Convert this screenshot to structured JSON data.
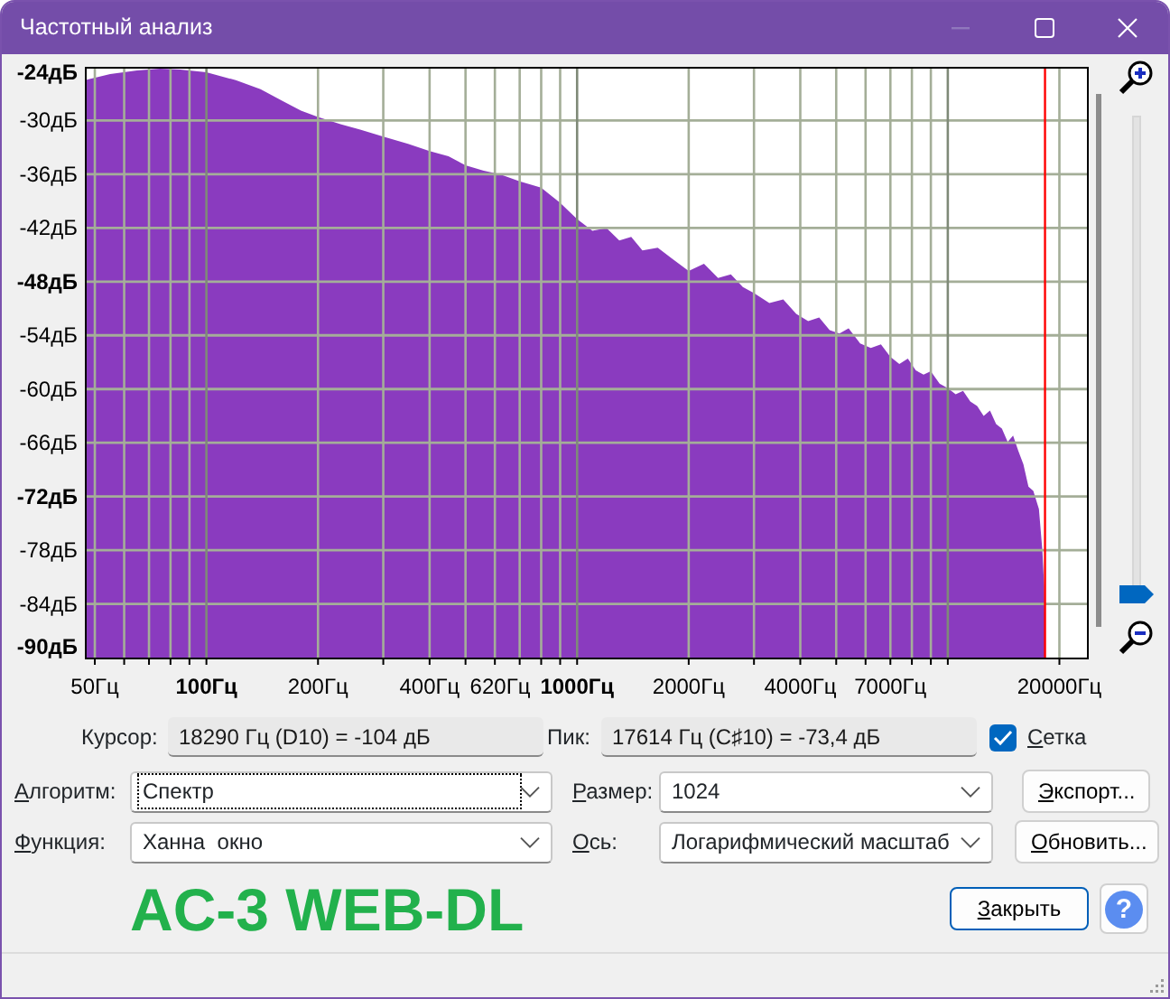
{
  "window": {
    "title": "Частотный анализ",
    "controls": [
      {
        "kind": "minimize",
        "disabled": true
      },
      {
        "kind": "maximize",
        "disabled": false
      },
      {
        "kind": "close",
        "disabled": false
      }
    ]
  },
  "spectrum": {
    "y_labels": [
      {
        "text": "-24дБ",
        "major": true
      },
      {
        "text": "-30дБ",
        "major": false
      },
      {
        "text": "-36дБ",
        "major": false
      },
      {
        "text": "-42дБ",
        "major": false
      },
      {
        "text": "-48дБ",
        "major": true
      },
      {
        "text": "-54дБ",
        "major": false
      },
      {
        "text": "-60дБ",
        "major": false
      },
      {
        "text": "-66дБ",
        "major": false
      },
      {
        "text": "-72дБ",
        "major": true
      },
      {
        "text": "-78дБ",
        "major": false
      },
      {
        "text": "-84дБ",
        "major": false
      },
      {
        "text": "-90дБ",
        "major": true
      }
    ],
    "x_labels": [
      {
        "text": "50Гц",
        "major": false
      },
      {
        "text": "100Гц",
        "major": true
      },
      {
        "text": "200Гц",
        "major": false
      },
      {
        "text": "400Гц",
        "major": false
      },
      {
        "text": "620Гц",
        "major": false
      },
      {
        "text": "1000Гц",
        "major": true
      },
      {
        "text": "2000Гц",
        "major": false
      },
      {
        "text": "4000Гц",
        "major": false
      },
      {
        "text": "7000Гц",
        "major": false
      },
      {
        "text": "20000Гц",
        "major": false
      }
    ]
  },
  "zoom": {
    "level": 0
  },
  "cursor": {
    "label": "Курсор:",
    "value": "18290 Гц (D10) = -104 дБ"
  },
  "peak": {
    "label": "Пик:",
    "value": "17614 Гц (C♯10) = -73,4 дБ"
  },
  "grid": {
    "label": "Сетка",
    "checked": true
  },
  "algorithm": {
    "label": "Алгоритм:",
    "value": "Спектр",
    "focused": true
  },
  "size": {
    "label": "Размер:",
    "value": "1024",
    "focused": false
  },
  "function": {
    "label": "Функция:",
    "value": "Ханна  окно",
    "focused": false
  },
  "axis": {
    "label": "Ось:",
    "value": "Логарифмический масштаб",
    "focused": false
  },
  "buttons": {
    "export": "Экспорт...",
    "refresh": "Обновить...",
    "close": "Закрыть",
    "help": "?"
  },
  "caption": "AC-3 WEB-DL"
}
